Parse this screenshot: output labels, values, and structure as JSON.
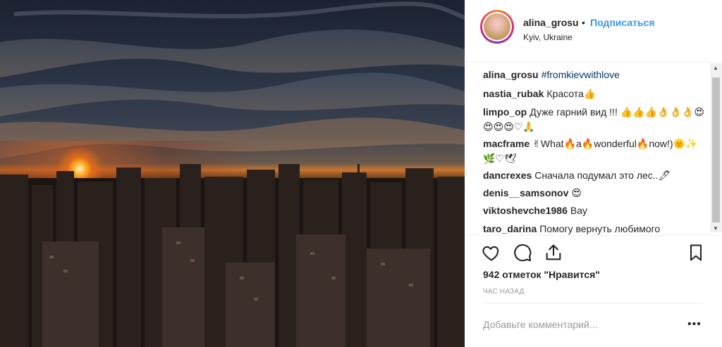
{
  "post": {
    "username": "alina_grosu",
    "dot": "•",
    "follow_label": "Подписаться",
    "location": "Kyiv, Ukraine",
    "image_alt": "Sunset over Kyiv city skyline"
  },
  "comments": [
    {
      "user": "alina_grosu",
      "text": "#fromkievwithlove",
      "is_hashtag": true
    },
    {
      "user": "nastia_rubak",
      "text": "Красота👍"
    },
    {
      "user": "limpo_op",
      "text": "Дуже гарний вид !!! 👍👍👍👌👌👌😍😍😍😍♡🙏"
    },
    {
      "user": "macframe",
      "text": "✌What🔥a🔥wonderful🔥now!)🌞✨🌿♡🕊"
    },
    {
      "user": "dancrexes",
      "text": "Сначала подумал это лес..🖊"
    },
    {
      "user": "denis__samsonov",
      "text": "😍"
    },
    {
      "user": "viktoshevche1986",
      "text": "Вау"
    },
    {
      "user": "taro_darina",
      "text": "Помогу вернуть любимого"
    }
  ],
  "actions": {
    "like_icon": "heart-icon",
    "comment_icon": "comment-icon",
    "share_icon": "share-icon",
    "save_icon": "bookmark-icon"
  },
  "likes_text": "942 отметок \"Нравится\"",
  "time_text": "ЧАС НАЗАД",
  "add_comment_placeholder": "Добавьте комментарий...",
  "more_label": "•••",
  "colors": {
    "link": "#3897f0",
    "text": "#262626",
    "muted": "#999999",
    "hashtag": "#003569"
  }
}
